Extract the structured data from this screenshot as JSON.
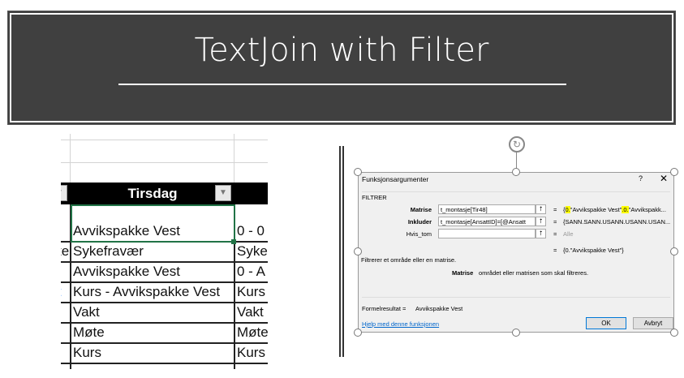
{
  "banner": {
    "title": "TextJoin with Filter"
  },
  "sheet": {
    "header": "Tirsdag",
    "rows": [
      {
        "col0": "",
        "col1": "Avvikspakke Vest",
        "col2": "0 - 0"
      },
      {
        "col0": "te",
        "col1": "Sykefravær",
        "col2": "Syke"
      },
      {
        "col0": "",
        "col1": "Avvikspakke Vest",
        "col2": "0 - A"
      },
      {
        "col0": "t",
        "col1": "Kurs - Avvikspakke Vest",
        "col2": "Kurs"
      },
      {
        "col0": "",
        "col1": "Vakt",
        "col2": "Vakt"
      },
      {
        "col0": "",
        "col1": "Møte",
        "col2": "Møte"
      },
      {
        "col0": "",
        "col1": "Kurs",
        "col2": "Kurs"
      }
    ]
  },
  "dialog": {
    "title": "Funksjonsargumenter",
    "help": "?",
    "close": "✕",
    "function": "FILTRER",
    "args": [
      {
        "label": "Matrise",
        "value": "t_montasje[Tir48]",
        "result_pre": "{",
        "hl1": "0.",
        "mid": "\"Avvikspakke Vest\"",
        "hl2": ".0.",
        "post": "\"Avvikspakk..."
      },
      {
        "label": "Inkluder",
        "value": "t_montasje[AnsattID]=[@Ansatt",
        "result": "{SANN.SANN.USANN.USANN.USAN..."
      },
      {
        "label": "Hvis_tom",
        "value": "",
        "result": "Alle"
      }
    ],
    "eq": "=",
    "overall_result": "{0.\"Avvikspakke Vest\"}",
    "description": "Filtrerer et område eller en matrise.",
    "arg_name": "Matrise",
    "arg_desc": "området eller matrisen som skal filtreres.",
    "formula_result_label": "Formelresultat =",
    "formula_result": "Avvikspakke Vest",
    "help_link": "Hjelp med denne funksjonen",
    "ok": "OK",
    "cancel": "Avbryt"
  }
}
